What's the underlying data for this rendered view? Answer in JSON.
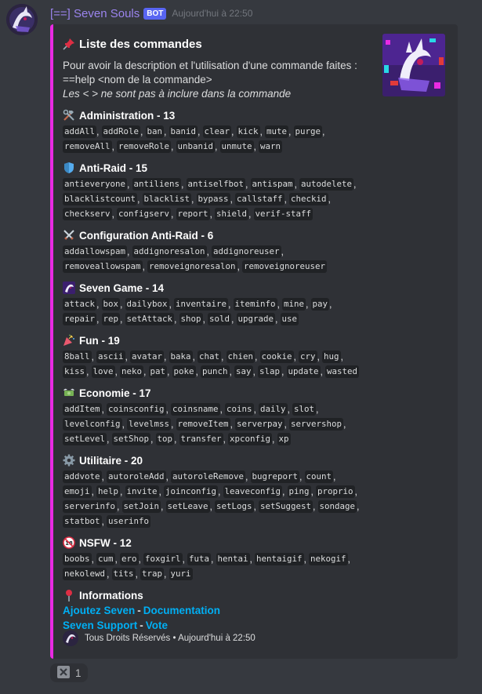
{
  "message": {
    "username": "[==] Seven Souls",
    "bot_tag": "BOT",
    "timestamp": "Aujourd'hui à 22:50"
  },
  "embed": {
    "border_color": "#e92ae3",
    "title": "Liste des commandes",
    "title_icon": "pushpin-icon",
    "description_line1": "Pour avoir la description et l'utilisation d'une commande faites :",
    "description_line2": "==help <nom de la commande>",
    "description_line3": "Les < > ne sont pas à inclure dans la commande",
    "fields": [
      {
        "name": "Administration - 13",
        "icon": "hammer-and-wrench-icon",
        "lines": [
          [
            "addAll",
            "addRole",
            "ban",
            "banid",
            "clear",
            "kick",
            "mute",
            "purge"
          ],
          [
            "removeAll",
            "removeRole",
            "unbanid",
            "unmute",
            "warn"
          ]
        ]
      },
      {
        "name": "Anti-Raid - 15",
        "icon": "shield-icon",
        "lines": [
          [
            "antieveryone",
            "antiliens",
            "antiselfbot",
            "antispam",
            "autodelete"
          ],
          [
            "blacklistcount",
            "blacklist",
            "bypass",
            "callstaff",
            "checkid"
          ],
          [
            "checkserv",
            "configserv",
            "report",
            "shield",
            "verif-staff"
          ]
        ]
      },
      {
        "name": "Configuration Anti-Raid - 6",
        "icon": "crossed-swords-icon",
        "lines": [
          [
            "addallowspam",
            "addignoresalon",
            "addignoreuser"
          ],
          [
            "removeallowspam",
            "removeignoresalon",
            "removeignoreuser"
          ]
        ]
      },
      {
        "name": "Seven Game - 14",
        "icon": "seven-logo-icon",
        "lines": [
          [
            "attack",
            "box",
            "dailybox",
            "inventaire",
            "iteminfo",
            "mine",
            "pay"
          ],
          [
            "repair",
            "rep",
            "setAttack",
            "shop",
            "sold",
            "upgrade",
            "use"
          ]
        ]
      },
      {
        "name": "Fun - 19",
        "icon": "party-popper-icon",
        "lines": [
          [
            "8ball",
            "ascii",
            "avatar",
            "baka",
            "chat",
            "chien",
            "cookie",
            "cry",
            "hug"
          ],
          [
            "kiss",
            "love",
            "neko",
            "pat",
            "poke",
            "punch",
            "say",
            "slap",
            "update",
            "wasted"
          ]
        ]
      },
      {
        "name": "Economie - 17",
        "icon": "money-with-wings-icon",
        "lines": [
          [
            "addItem",
            "coinsconfig",
            "coinsname",
            "coins",
            "daily",
            "slot"
          ],
          [
            "levelconfig",
            "levelmss",
            "removeItem",
            "serverpay",
            "servershop"
          ],
          [
            "setLevel",
            "setShop",
            "top",
            "transfer",
            "xpconfig",
            "xp"
          ]
        ]
      },
      {
        "name": "Utilitaire - 20",
        "icon": "gear-icon",
        "lines": [
          [
            "addvote",
            "autoroleAdd",
            "autoroleRemove",
            "bugreport",
            "count"
          ],
          [
            "emoji",
            "help",
            "invite",
            "joinconfig",
            "leaveconfig",
            "ping",
            "proprio"
          ],
          [
            "serverinfo",
            "setJoin",
            "setLeave",
            "setLogs",
            "setSuggest",
            "sondage"
          ],
          [
            "statbot",
            "userinfo"
          ]
        ]
      },
      {
        "name": "NSFW - 12",
        "icon": "no-under-18-icon",
        "lines": [
          [
            "boobs",
            "cum",
            "ero",
            "foxgirl",
            "futa",
            "hentai",
            "hentaigif",
            "nekogif"
          ],
          [
            "nekolewd",
            "tits",
            "trap",
            "yuri"
          ]
        ]
      }
    ],
    "info": {
      "name": "Informations",
      "icon": "round-pushpin-icon",
      "link1": "Ajoutez Seven",
      "link2": "Documentation",
      "link3": "Seven Support",
      "link4": "Vote",
      "separator": "-"
    },
    "footer": {
      "text": "Tous Droits Réservés • Aujourd'hui à 22:50"
    }
  },
  "reaction": {
    "icon": "cross-mark-button-icon",
    "count": "1"
  },
  "colors": {
    "background": "#36393f",
    "embed_bg": "#2f3136",
    "username": "#9b84ee",
    "link": "#00aff4",
    "bot_tag": "#5865f2"
  }
}
